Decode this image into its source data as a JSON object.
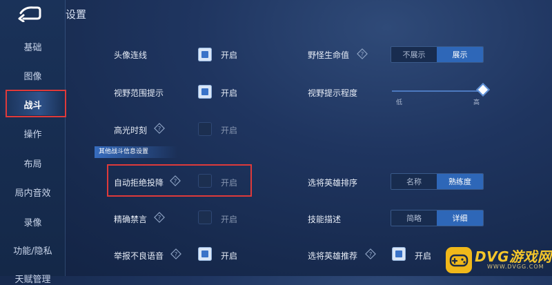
{
  "header": {
    "title": "设置"
  },
  "sidebar": {
    "items": [
      {
        "label": "基础"
      },
      {
        "label": "图像"
      },
      {
        "label": "战斗",
        "active": true
      },
      {
        "label": "操作"
      },
      {
        "label": "布局"
      },
      {
        "label": "局内音效"
      },
      {
        "label": "录像"
      },
      {
        "label": "功能/隐私"
      },
      {
        "label": "天赋管理"
      }
    ]
  },
  "settings": {
    "avatar_connect": {
      "label": "头像连线",
      "state_label": "开启",
      "checked": true
    },
    "vision_hint": {
      "label": "视野范围提示",
      "state_label": "开启",
      "checked": true
    },
    "highlight": {
      "label": "高光时刻",
      "state_label": "开启",
      "checked": false
    },
    "monster_hp": {
      "label": "野怪生命值",
      "options": [
        "不展示",
        "展示"
      ],
      "selected": 1
    },
    "vision_level": {
      "label": "视野提示程度",
      "low": "低",
      "high": "高",
      "value": 1.0
    }
  },
  "section": {
    "title": "其他战斗信息设置"
  },
  "other": {
    "auto_reject": {
      "label": "自动拒绝投降",
      "state_label": "开启",
      "checked": false
    },
    "precise_ban": {
      "label": "精确禁言",
      "state_label": "开启",
      "checked": false
    },
    "report_voice": {
      "label": "举报不良语音",
      "state_label": "开启",
      "checked": true
    },
    "hero_sort": {
      "label": "选将英雄排序",
      "options": [
        "名称",
        "熟练度"
      ],
      "selected": 1
    },
    "skill_desc": {
      "label": "技能描述",
      "options": [
        "简略",
        "详细"
      ],
      "selected": 1
    },
    "hero_recommend": {
      "label": "选将英雄推荐",
      "state_label": "开启",
      "checked": true
    }
  },
  "watermark": {
    "title": "DVG游戏网",
    "url": "WWW.DVGG.COM"
  },
  "colors": {
    "accent": "#2e67b8",
    "highlight_box": "#e03a3a",
    "watermark": "#f0b81a"
  }
}
